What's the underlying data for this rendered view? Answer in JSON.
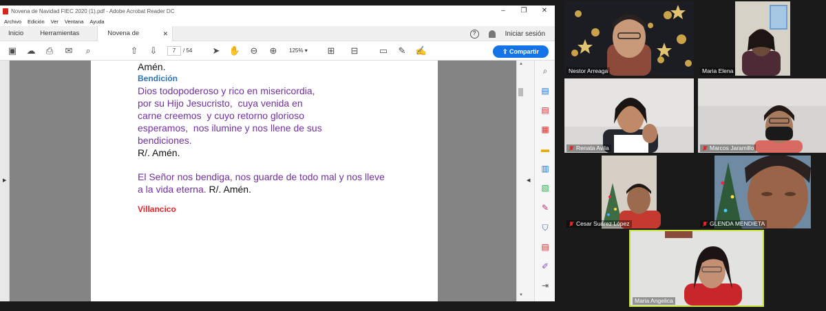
{
  "acrobat": {
    "window_title": "Novena de Navidad FIEC 2020 (1).pdf - Adobe Acrobat Reader DC",
    "menu": [
      "Archivo",
      "Edición",
      "Ver",
      "Ventana",
      "Ayuda"
    ],
    "tabs": {
      "home": "Inicio",
      "tools": "Herramientas",
      "document": "Novena de Navida..."
    },
    "help": "?",
    "sign_in": "Iniciar sesión",
    "page_current": "7",
    "page_total": "/ 54",
    "zoom": "125%",
    "share_label": "Compartir",
    "accent_color": "#1473e6"
  },
  "pdf": {
    "line_amen_top": "Amén.",
    "heading_bendicion": "Bendición",
    "blessing_lines": [
      "Dios todopoderoso y rico en misericordia,",
      "por su Hijo Jesucristo,  cuya venida en",
      "carne creemos  y cuyo retorno glorioso",
      "esperamos,  nos ilumine y nos llene de sus",
      "bendiciones."
    ],
    "response_1": "R/. Amén.",
    "closing_line_1": "El Señor nos bendiga, nos guarde de todo mal y nos lleve",
    "closing_line_2_purple": "a la vida eterna.",
    "closing_line_2_black": " R/. Amén.",
    "heading_villancico": "Villancico",
    "colors": {
      "purple": "#7030a0",
      "blue": "#2e74b5",
      "red": "#e3262a"
    }
  },
  "participants": [
    {
      "name": "Nestor Arreaga",
      "muted": false
    },
    {
      "name": "Maria Elena",
      "muted": false
    },
    {
      "name": "Renata Avila",
      "muted": true
    },
    {
      "name": "Marcos Jaramillo",
      "muted": true
    },
    {
      "name": "Cesar Suárez López",
      "muted": true
    },
    {
      "name": "GLENDA MENDIETA",
      "muted": true
    },
    {
      "name": "Maria Angelica",
      "muted": false,
      "active_speaker": true
    }
  ]
}
